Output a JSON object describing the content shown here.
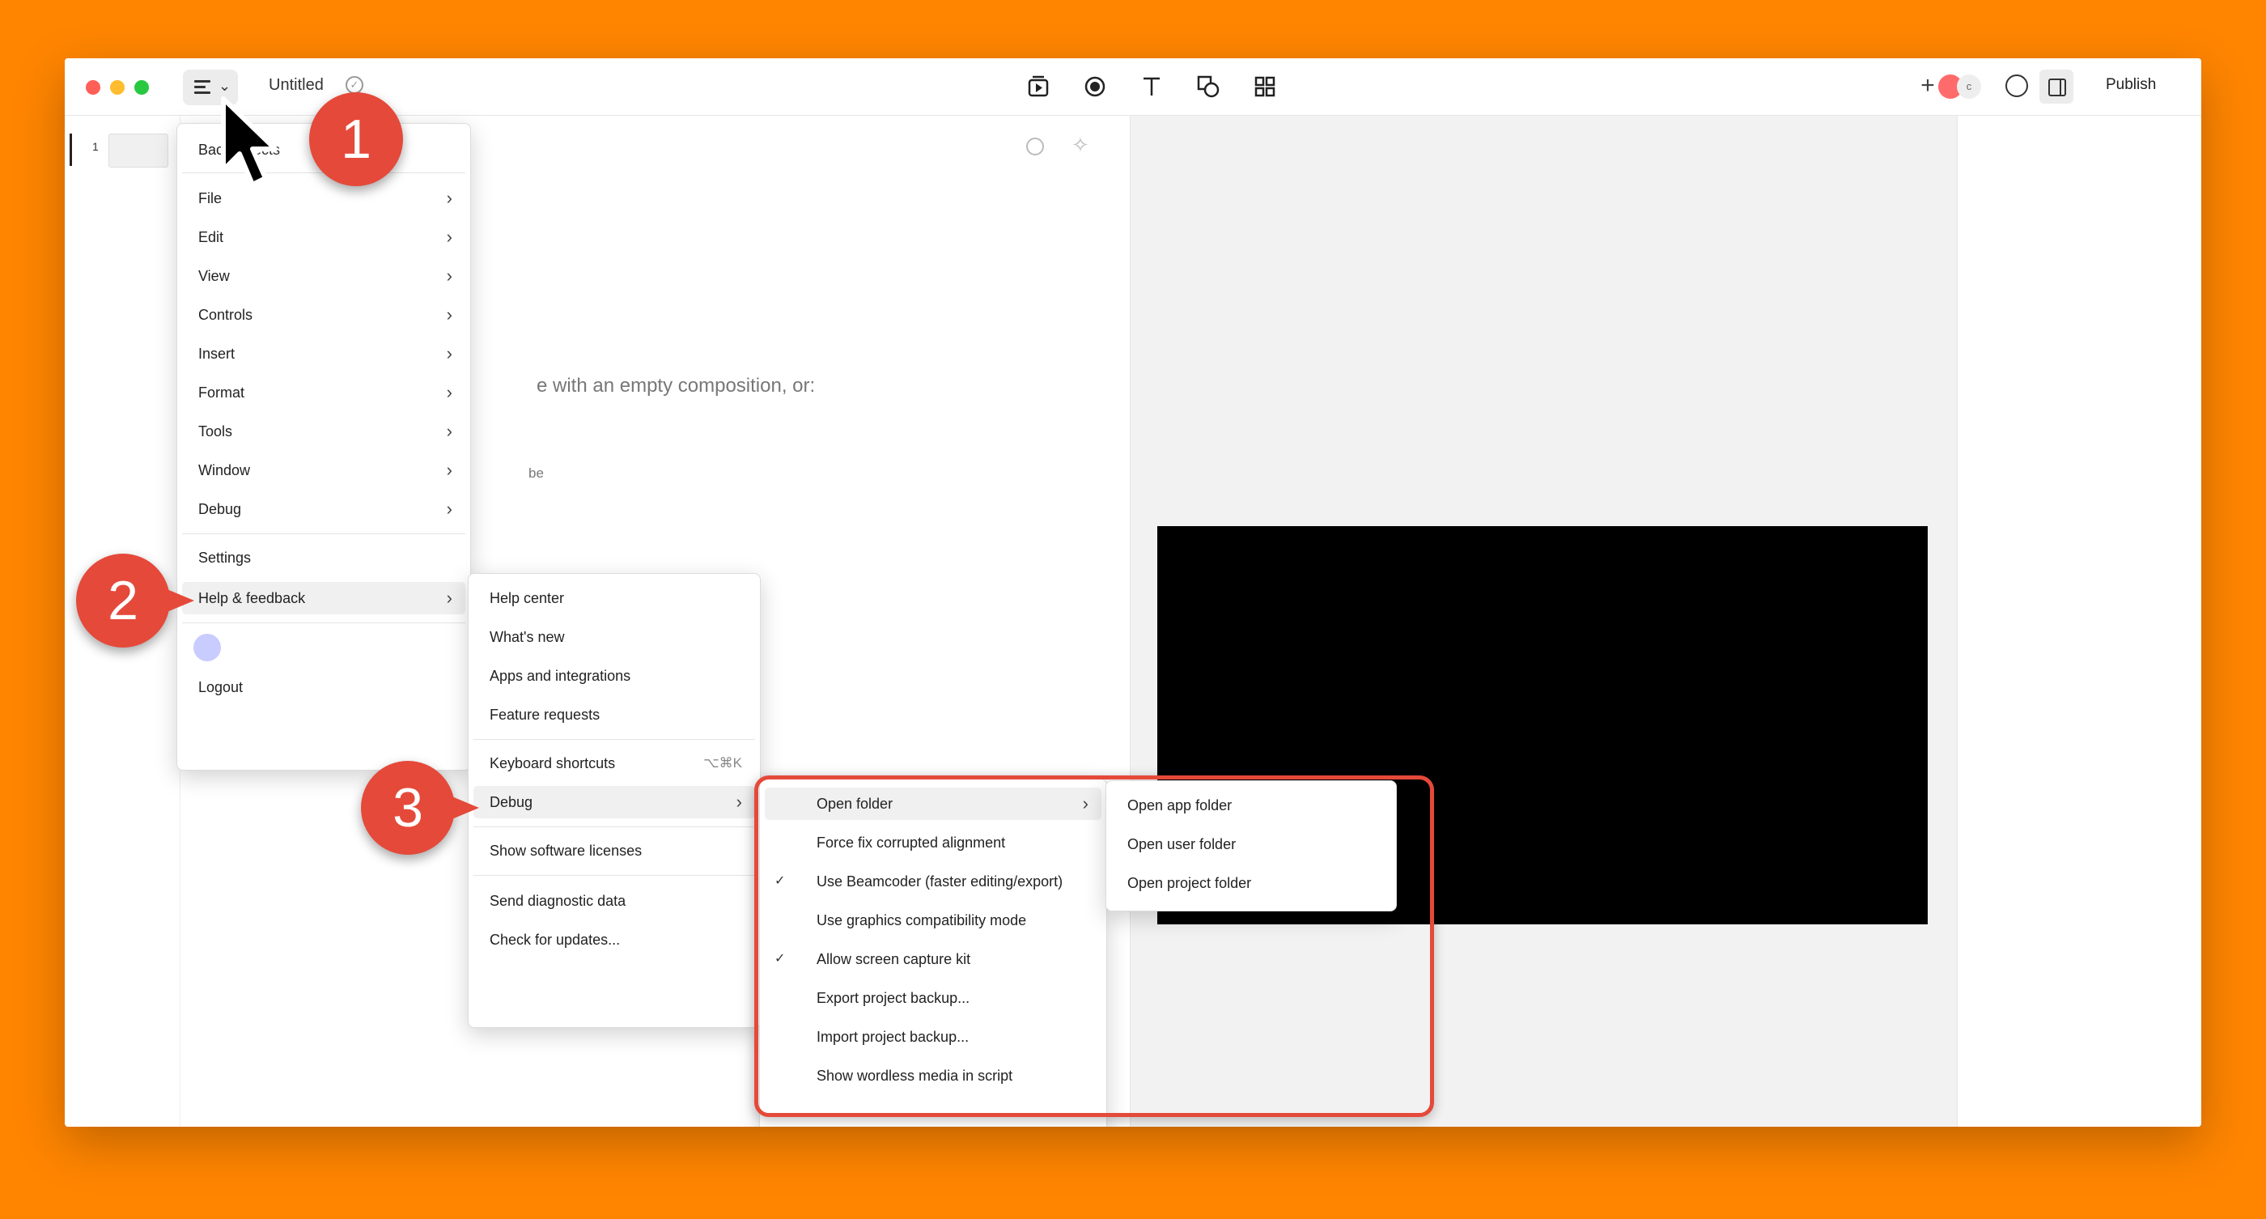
{
  "theme": {
    "background": "#ff8500",
    "accent": "#e5493a"
  },
  "titlebar": {
    "doc_title": "Untitled",
    "publish_label": "Publish",
    "collaborator_initial": "c"
  },
  "scenes": [
    {
      "number": "1"
    }
  ],
  "script_ghost": {
    "line1": "e with an empty composition, or:",
    "line2": "be",
    "line3": "ects"
  },
  "main_menu": {
    "back": "Back",
    "items": [
      "File",
      "Edit",
      "View",
      "Controls",
      "Insert",
      "Format",
      "Tools",
      "Window",
      "Debug"
    ],
    "settings": "Settings",
    "help": "Help & feedback",
    "logout": "Logout"
  },
  "help_menu": {
    "group1": [
      "Help center",
      "What's new",
      "Apps and integrations",
      "Feature requests"
    ],
    "keyboard_shortcuts": "Keyboard shortcuts",
    "keyboard_shortcuts_key": "⌥⌘K",
    "debug": "Debug",
    "licenses": "Show software licenses",
    "group3": [
      "Send diagnostic data",
      "Check for updates..."
    ]
  },
  "debug_menu": {
    "open_folder": "Open folder",
    "items": [
      {
        "label": "Force fix corrupted alignment",
        "checked": false
      },
      {
        "label": "Use Beamcoder (faster editing/export)",
        "checked": true
      },
      {
        "label": "Use graphics compatibility mode",
        "checked": false
      },
      {
        "label": "Allow screen capture kit",
        "checked": true
      },
      {
        "label": "Export project backup...",
        "checked": false
      },
      {
        "label": "Import project backup...",
        "checked": false
      },
      {
        "label": "Show wordless media in script",
        "checked": false
      }
    ]
  },
  "folder_menu": {
    "items": [
      "Open app folder",
      "Open user folder",
      "Open project folder"
    ]
  },
  "badges": {
    "b1": "1",
    "b2": "2",
    "b3": "3"
  },
  "icons": {
    "chevron": "›",
    "check": "✓"
  }
}
